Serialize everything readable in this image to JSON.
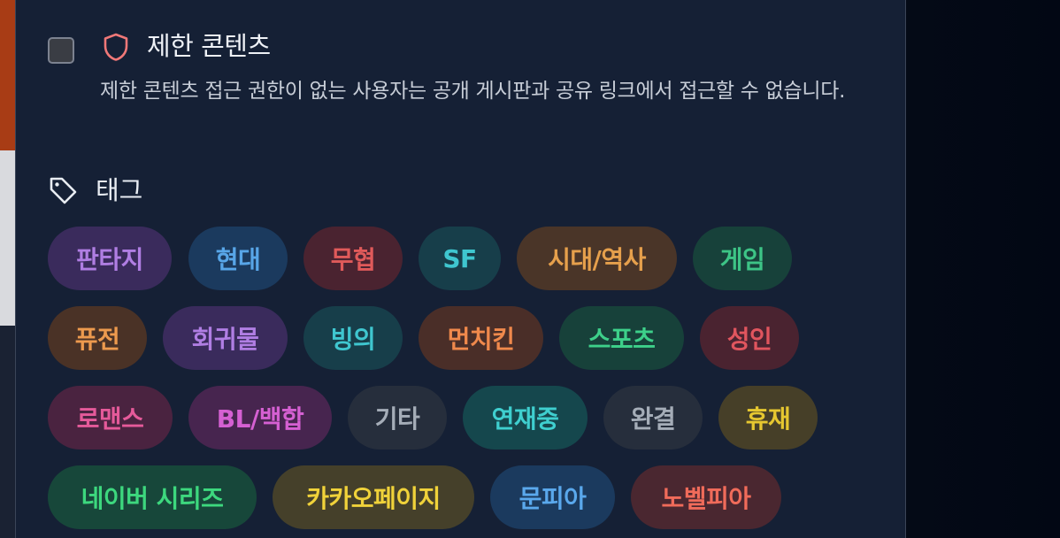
{
  "restricted": {
    "title": "제한 콘텐츠",
    "description": "제한 콘텐츠 접근 권한이 없는 사용자는 공개 게시판과 공유 링크에서 접근할 수 없습니다.",
    "checked": false,
    "icon": "shield-icon"
  },
  "tags": {
    "title": "태그",
    "icon": "tag-icon",
    "items": [
      {
        "label": "판타지",
        "text_color": "#b07ee3",
        "bg_color": "#3a2b5c"
      },
      {
        "label": "현대",
        "text_color": "#58a6e8",
        "bg_color": "#1b3a5e"
      },
      {
        "label": "무협",
        "text_color": "#e05a5a",
        "bg_color": "#4a2330"
      },
      {
        "label": "SF",
        "text_color": "#3fc6cf",
        "bg_color": "#173e4a"
      },
      {
        "label": "시대/역사",
        "text_color": "#e6a04c",
        "bg_color": "#4a3528"
      },
      {
        "label": "게임",
        "text_color": "#3dc486",
        "bg_color": "#17413a"
      },
      {
        "label": "퓨전",
        "text_color": "#ed9a4e",
        "bg_color": "#4a3226"
      },
      {
        "label": "회귀물",
        "text_color": "#b07ee3",
        "bg_color": "#3a2b5c"
      },
      {
        "label": "빙의",
        "text_color": "#3fc6cf",
        "bg_color": "#173e4a"
      },
      {
        "label": "먼치킨",
        "text_color": "#f0894c",
        "bg_color": "#4a2e28"
      },
      {
        "label": "스포츠",
        "text_color": "#3dd08a",
        "bg_color": "#17413a"
      },
      {
        "label": "성인",
        "text_color": "#e0555e",
        "bg_color": "#4a2330"
      },
      {
        "label": "로맨스",
        "text_color": "#e55a9a",
        "bg_color": "#4a2340"
      },
      {
        "label": "BL/백합",
        "text_color": "#d560d2",
        "bg_color": "#47254f"
      },
      {
        "label": "기타",
        "text_color": "#a5adb8",
        "bg_color": "#262e3c"
      },
      {
        "label": "연재중",
        "text_color": "#3fcfcf",
        "bg_color": "#15474d"
      },
      {
        "label": "완결",
        "text_color": "#a5adb8",
        "bg_color": "#262e3c"
      },
      {
        "label": "휴재",
        "text_color": "#e6c730",
        "bg_color": "#463f28"
      },
      {
        "label": "네이버 시리즈",
        "text_color": "#3dd87e",
        "bg_color": "#17473a"
      },
      {
        "label": "카카오페이지",
        "text_color": "#f0d23a",
        "bg_color": "#45402a"
      },
      {
        "label": "문피아",
        "text_color": "#5aa8ec",
        "bg_color": "#1b3a5e"
      },
      {
        "label": "노벨피아",
        "text_color": "#f06b5a",
        "bg_color": "#4a2730"
      }
    ]
  }
}
